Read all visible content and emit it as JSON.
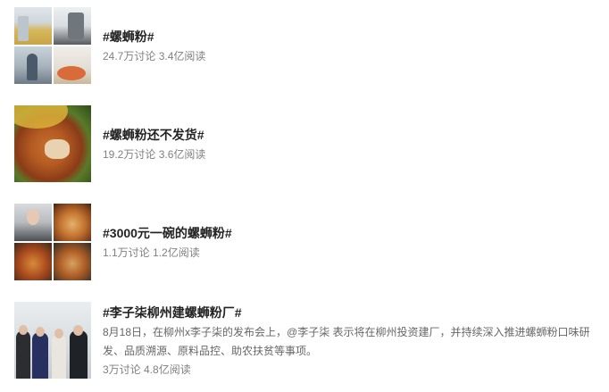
{
  "topics": [
    {
      "title": "#螺蛳粉#",
      "meta": "24.7万讨论 3.4亿阅读",
      "description": "",
      "thumbnail": {
        "layout": "grid-2x2",
        "icons": [
          "street-photo",
          "shop-photo",
          "crowd-photo",
          "food-bowl-photo"
        ]
      }
    },
    {
      "title": "#螺蛳粉还不发货#",
      "meta": "19.2万讨论 3.6亿阅读",
      "description": "",
      "thumbnail": {
        "layout": "single",
        "icons": [
          "noodle-bowl-photo"
        ]
      }
    },
    {
      "title": "#3000元一碗的螺蛳粉#",
      "meta": "1.1万讨论 1.2亿阅读",
      "description": "",
      "thumbnail": {
        "layout": "grid-2x2",
        "icons": [
          "person-photo",
          "noodle-photo",
          "noodle-photo",
          "noodle-photo"
        ]
      }
    },
    {
      "title": "#李子柒柳州建螺蛳粉厂#",
      "meta": "3万讨论 4.8亿阅读",
      "description": "8月18日，在柳州x李子柒的发布会上，@李子柒 表示将在柳州投资建厂，并持续深入推进螺蛳粉口味研发、品质溯源、原料品控、助农扶贫等事项。",
      "thumbnail": {
        "layout": "single",
        "icons": [
          "group-photo"
        ]
      }
    }
  ]
}
